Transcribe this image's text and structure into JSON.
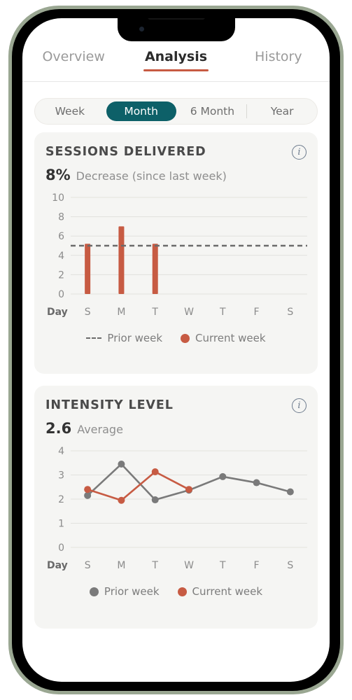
{
  "device": {
    "frame_color": "#9aa792",
    "bezel_color": "#000000",
    "notch": "notch"
  },
  "tabs": [
    {
      "label": "Overview",
      "active": false
    },
    {
      "label": "Analysis",
      "active": true
    },
    {
      "label": "History",
      "active": false
    }
  ],
  "segmented": {
    "active_color": "#0d6068",
    "options": [
      {
        "label": "Week",
        "active": false
      },
      {
        "label": "Month",
        "active": true
      },
      {
        "label": "6 Month",
        "active": false
      },
      {
        "label": "Year",
        "active": false
      }
    ]
  },
  "colors": {
    "current_week": "#c75b43",
    "prior_week": "#7a7a7a",
    "accent_teal": "#0d6068",
    "card_bg": "#f5f5f3",
    "grid": "#e2e2de"
  },
  "cards": [
    {
      "title": "SESSIONS DELIVERED",
      "info_icon": "info-circle-icon",
      "value": "8%",
      "value_label": "Decrease (since last week)"
    },
    {
      "title": "INTENSITY LEVEL",
      "info_icon": "info-circle-icon",
      "value": "2.6",
      "value_label": "Average"
    }
  ],
  "chart_data": [
    {
      "type": "bar",
      "title": "SESSIONS DELIVERED",
      "xlabel": "Day",
      "ylabel": "",
      "categories": [
        "S",
        "M",
        "T",
        "W",
        "T",
        "F",
        "S"
      ],
      "yticks": [
        0,
        2,
        4,
        6,
        8,
        10
      ],
      "ylim": [
        0,
        10
      ],
      "grid": true,
      "series": [
        {
          "name": "Current week",
          "style": "bar",
          "color": "#c75b43",
          "values": [
            5.2,
            7.0,
            5.2,
            null,
            null,
            null,
            null
          ]
        },
        {
          "name": "Prior week",
          "style": "dashed-threshold",
          "color": "#6b6b6b",
          "threshold": 5.0
        }
      ],
      "legend": [
        {
          "label": "Prior week",
          "marker": "dashed-line",
          "color": "#6b6b6b"
        },
        {
          "label": "Current week",
          "marker": "dot",
          "color": "#c75b43"
        }
      ],
      "legend_position": "bottom"
    },
    {
      "type": "line",
      "title": "INTENSITY LEVEL",
      "xlabel": "Day",
      "ylabel": "",
      "categories": [
        "S",
        "M",
        "T",
        "W",
        "T",
        "F",
        "S"
      ],
      "yticks": [
        0,
        1,
        2,
        3,
        4
      ],
      "ylim": [
        0,
        4
      ],
      "grid": true,
      "series": [
        {
          "name": "Prior week",
          "style": "line",
          "color": "#7a7a7a",
          "values": [
            2.15,
            3.45,
            1.97,
            2.37,
            2.93,
            2.68,
            2.3
          ]
        },
        {
          "name": "Current week",
          "style": "line",
          "color": "#c75b43",
          "values": [
            2.4,
            1.95,
            3.13,
            2.4,
            null,
            null,
            null
          ]
        }
      ],
      "legend": [
        {
          "label": "Prior week",
          "marker": "dot",
          "color": "#7a7a7a"
        },
        {
          "label": "Current week",
          "marker": "dot",
          "color": "#c75b43"
        }
      ],
      "legend_position": "bottom"
    }
  ]
}
